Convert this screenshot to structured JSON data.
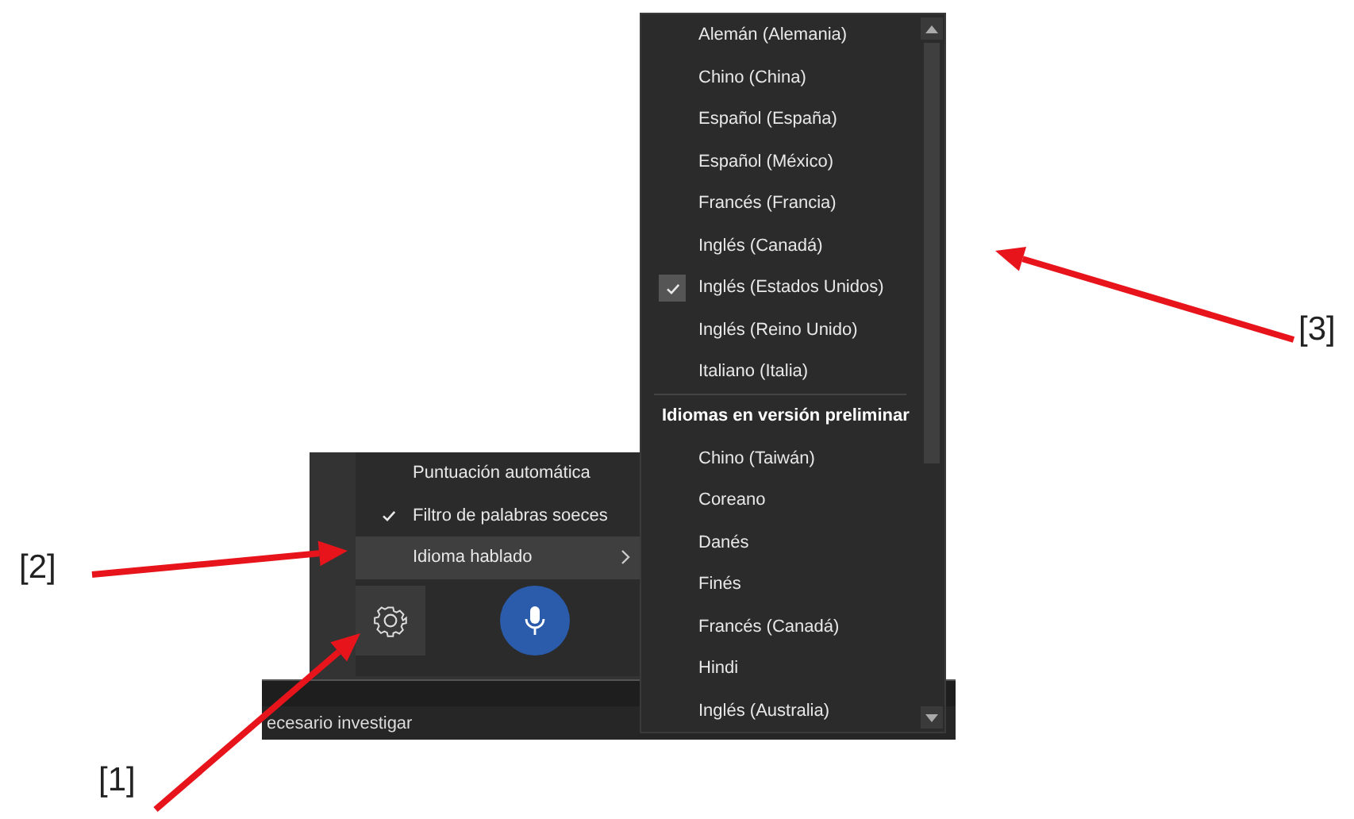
{
  "settings_menu": {
    "items": [
      {
        "label": "Puntuación automática",
        "kind": "toggle",
        "checked": false,
        "selected": false
      },
      {
        "label": "Filtro de palabras soeces",
        "kind": "toggle",
        "checked": true,
        "selected": false
      },
      {
        "label": "Idioma hablado",
        "kind": "submenu",
        "checked": false,
        "selected": true
      }
    ]
  },
  "transcript": {
    "text": "ecesario investigar"
  },
  "language_menu": {
    "languages": [
      {
        "label": "Alemán (Alemania)",
        "checked": false
      },
      {
        "label": "Chino (China)",
        "checked": false
      },
      {
        "label": "Español (España)",
        "checked": false
      },
      {
        "label": "Español (México)",
        "checked": false
      },
      {
        "label": "Francés (Francia)",
        "checked": false
      },
      {
        "label": "Inglés (Canadá)",
        "checked": false
      },
      {
        "label": "Inglés (Estados Unidos)",
        "checked": true
      },
      {
        "label": "Inglés (Reino Unido)",
        "checked": false
      },
      {
        "label": "Italiano (Italia)",
        "checked": false
      }
    ],
    "preview_header": "Idiomas en versión preliminar",
    "preview_languages": [
      {
        "label": "Chino (Taiwán)",
        "checked": false
      },
      {
        "label": "Coreano",
        "checked": false
      },
      {
        "label": "Danés",
        "checked": false
      },
      {
        "label": "Finés",
        "checked": false
      },
      {
        "label": "Francés (Canadá)",
        "checked": false
      },
      {
        "label": "Hindi",
        "checked": false
      },
      {
        "label": "Inglés (Australia)",
        "checked": false
      }
    ]
  },
  "annotations": [
    {
      "label": "[1]"
    },
    {
      "label": "[2]"
    },
    {
      "label": "[3]"
    }
  ]
}
